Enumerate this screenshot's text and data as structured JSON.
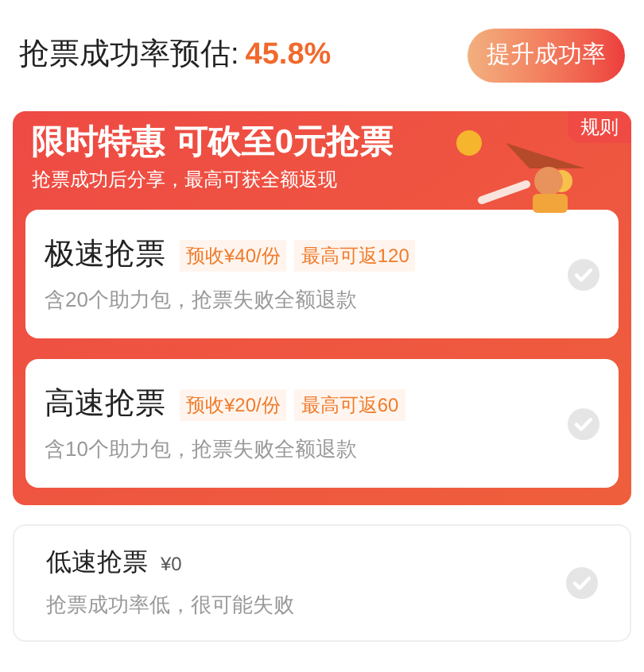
{
  "header": {
    "label": "抢票成功率预估:",
    "rate": "45.8%",
    "button": "提升成功率"
  },
  "promo": {
    "title": "限时特惠 可砍至0元抢票",
    "subtitle": "抢票成功后分享，最高可获全额返现",
    "rules": "规则",
    "options": [
      {
        "name": "极速抢票",
        "tags": [
          "预收¥40/份",
          "最高可返120"
        ],
        "desc": "含20个助力包，抢票失败全额退款",
        "selected": false
      },
      {
        "name": "高速抢票",
        "tags": [
          "预收¥20/份",
          "最高可返60"
        ],
        "desc": "含10个助力包，抢票失败全额退款",
        "selected": false
      }
    ]
  },
  "basic": {
    "name": "低速抢票",
    "price": "¥0",
    "desc": "抢票成功率低，很可能失败",
    "selected": false
  }
}
